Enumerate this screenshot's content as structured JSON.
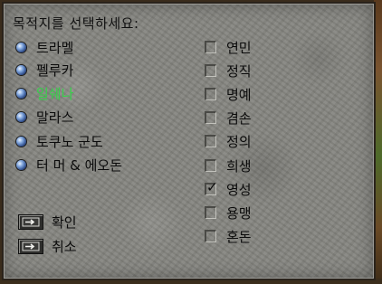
{
  "title": "목적지를 선택하세요:",
  "destinations": [
    {
      "label": "트라멜",
      "selected": false
    },
    {
      "label": "펠루카",
      "selected": false
    },
    {
      "label": "일쉐나",
      "selected": true
    },
    {
      "label": "말라스",
      "selected": false
    },
    {
      "label": "토쿠노 군도",
      "selected": false
    },
    {
      "label": "터 머 & 에오돈",
      "selected": false
    }
  ],
  "virtues": [
    {
      "label": "연민",
      "checked": false
    },
    {
      "label": "정직",
      "checked": false
    },
    {
      "label": "명예",
      "checked": false
    },
    {
      "label": "겸손",
      "checked": false
    },
    {
      "label": "정의",
      "checked": false
    },
    {
      "label": "희생",
      "checked": false
    },
    {
      "label": "영성",
      "checked": true
    },
    {
      "label": "용맹",
      "checked": false
    },
    {
      "label": "혼돈",
      "checked": false
    }
  ],
  "check_glyph": "✓",
  "buttons": {
    "ok_label": "확인",
    "cancel_label": "취소"
  },
  "colors": {
    "selected_text": "#36d24a",
    "stone": "#84847f"
  }
}
